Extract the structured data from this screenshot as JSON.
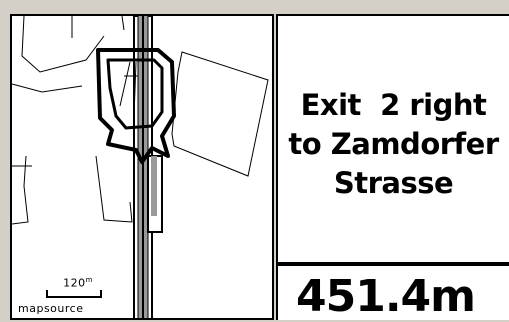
{
  "map": {
    "scale_value": "120",
    "scale_unit": "m",
    "source_label": "mapsource"
  },
  "guidance": {
    "line1": "Exit  2 right",
    "line2": "to Zamdorfer",
    "line3": "Strasse"
  },
  "distance": {
    "value": "451.4m"
  }
}
